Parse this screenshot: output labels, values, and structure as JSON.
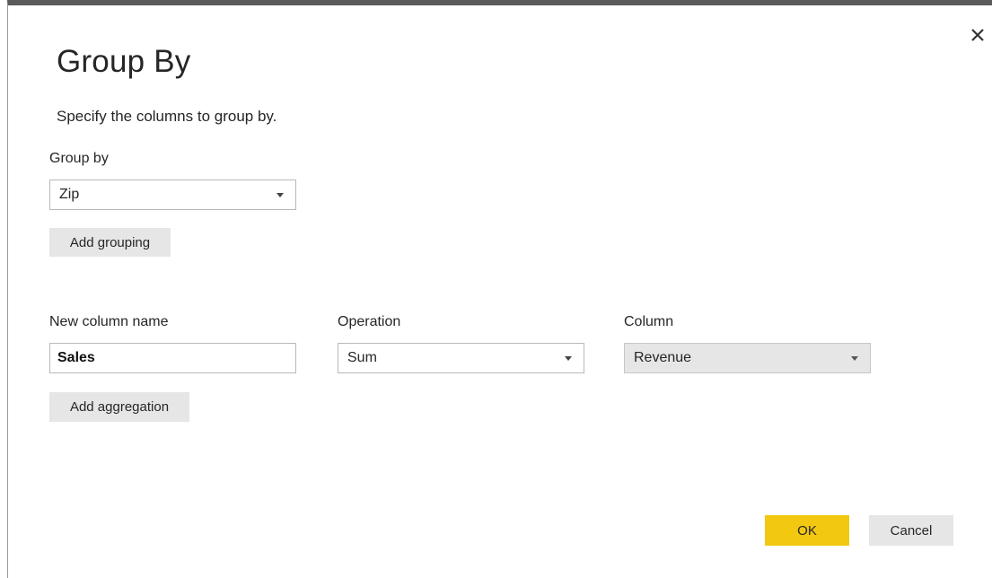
{
  "dialog": {
    "title": "Group By",
    "subtitle": "Specify the columns to group by."
  },
  "grouping": {
    "label": "Group by",
    "selected": "Zip",
    "add_button": "Add grouping"
  },
  "aggregation": {
    "new_column_label": "New column name",
    "new_column_value": "Sales",
    "operation_label": "Operation",
    "operation_selected": "Sum",
    "column_label": "Column",
    "column_selected": "Revenue",
    "add_button": "Add aggregation"
  },
  "footer": {
    "ok_label": "OK",
    "cancel_label": "Cancel"
  },
  "colors": {
    "primary_button": "#f2c811",
    "secondary_button": "#e6e6e6",
    "title_bar": "#5a5a5a"
  },
  "icons": {
    "close": "close-icon",
    "dropdown": "chevron-down-icon"
  }
}
